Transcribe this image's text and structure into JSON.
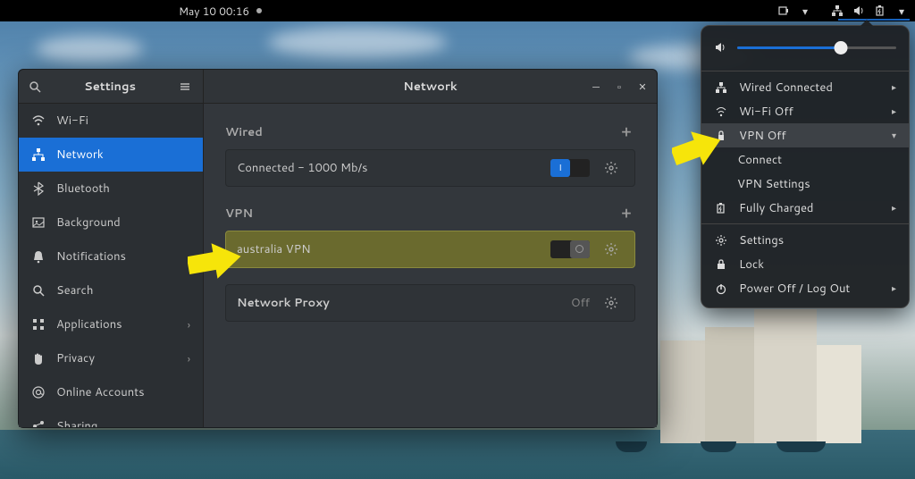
{
  "topbar": {
    "datetime": "May 10  00:16"
  },
  "settings": {
    "sidebar_title": "Settings",
    "main_title": "Network",
    "items": [
      {
        "icon": "wifi",
        "label": "Wi-Fi"
      },
      {
        "icon": "network",
        "label": "Network",
        "selected": true
      },
      {
        "icon": "bluetooth",
        "label": "Bluetooth"
      },
      {
        "icon": "background",
        "label": "Background"
      },
      {
        "icon": "bell",
        "label": "Notifications"
      },
      {
        "icon": "search",
        "label": "Search"
      },
      {
        "icon": "apps",
        "label": "Applications",
        "submenu": true
      },
      {
        "icon": "hand",
        "label": "Privacy",
        "submenu": true
      },
      {
        "icon": "at",
        "label": "Online Accounts"
      },
      {
        "icon": "share",
        "label": "Sharing"
      }
    ],
    "wired": {
      "header": "Wired",
      "status": "Connected - 1000 Mb/s",
      "on": true
    },
    "vpn": {
      "header": "VPN",
      "name": "australia VPN",
      "on": false
    },
    "proxy": {
      "label": "Network Proxy",
      "status": "Off"
    }
  },
  "sysmenu": {
    "volume_pct": 65,
    "items": [
      {
        "icon": "wired",
        "label": "Wired Connected",
        "chev": true
      },
      {
        "icon": "wifi",
        "label": "Wi-Fi Off",
        "chev": true
      },
      {
        "icon": "vpn",
        "label": "VPN Off",
        "chev": "down",
        "selected": true
      },
      {
        "sub": true,
        "label": "Connect"
      },
      {
        "sub": true,
        "label": "VPN Settings"
      },
      {
        "icon": "battery",
        "label": "Fully Charged",
        "chev": true
      },
      {
        "sep": true
      },
      {
        "icon": "gear",
        "label": "Settings"
      },
      {
        "icon": "lock",
        "label": "Lock"
      },
      {
        "icon": "power",
        "label": "Power Off / Log Out",
        "chev": true
      }
    ]
  }
}
